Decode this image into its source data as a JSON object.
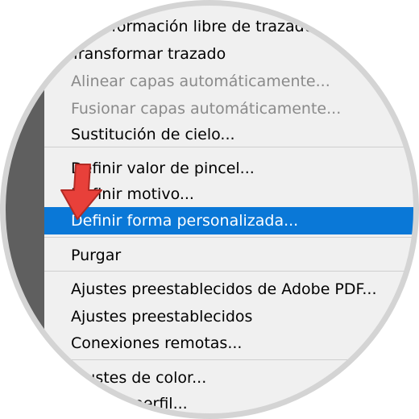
{
  "menu": {
    "items": [
      {
        "label": "Transformación libre de trazado",
        "state": "normal"
      },
      {
        "label": "Transformar trazado",
        "state": "normal"
      },
      {
        "label": "Alinear capas automáticamente...",
        "state": "disabled"
      },
      {
        "label": "Fusionar capas automáticamente...",
        "state": "disabled"
      },
      {
        "label": "Sustitución de cielo...",
        "state": "normal"
      },
      {
        "label": "Definir valor de pincel...",
        "state": "normal"
      },
      {
        "label": "Definir motivo...",
        "state": "normal"
      },
      {
        "label": "Definir forma personalizada...",
        "state": "highlighted"
      },
      {
        "label": "Purgar",
        "state": "normal"
      },
      {
        "label": "Ajustes preestablecidos de Adobe PDF...",
        "state": "normal"
      },
      {
        "label": "Ajustes preestablecidos",
        "state": "normal"
      },
      {
        "label": "Conexiones remotas...",
        "state": "normal"
      },
      {
        "label": "Ajustes de color...",
        "state": "normal"
      },
      {
        "label": "Asignar perfil...",
        "state": "normal"
      }
    ]
  },
  "colors": {
    "highlight": "#0a78d7",
    "disabled_text": "#8a8a8a",
    "menu_background": "#f0f0f0",
    "arrow": "#e8403a"
  },
  "annotation": {
    "icon": "red-pointer-arrow-icon"
  }
}
